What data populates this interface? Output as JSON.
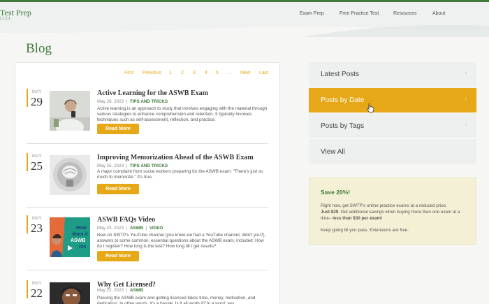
{
  "header": {
    "logo": "Test Prep",
    "logo_sub": "LLCd",
    "nav": [
      "Exam Prep",
      "Free Practice Test",
      "Resources",
      "About"
    ]
  },
  "page_title": "Blog",
  "pagination": {
    "first": "First",
    "previous": "Previous",
    "pages": [
      "1",
      "2",
      "3",
      "4",
      "5"
    ],
    "ellipsis": "...",
    "next": "Next",
    "last": "Last"
  },
  "posts": [
    {
      "month": "MAY",
      "day": "29",
      "title": "Active Learning for the ASWB Exam",
      "date": "May 29, 2023",
      "tags": [
        "TIPS AND TRICKS"
      ],
      "excerpt": "Active learning is an approach to study that involves engaging with the material through various strategies to enhance comprehension and retention. It typically involves techniques such as self-assessment, reflection, and practice.",
      "button": "Read More"
    },
    {
      "month": "MAY",
      "day": "25",
      "title": "Improving Memorization Ahead of the ASWB Exam",
      "date": "May 25, 2023",
      "tags": [
        "TIPS AND TRICKS"
      ],
      "excerpt": "A major complaint from social workers preparing for the ASWB exam: \"There's just so much to memorize.\"  It's true.",
      "button": "Read More"
    },
    {
      "month": "MAY",
      "day": "23",
      "title": "ASWB FAQs Video",
      "date": "May 23, 2023",
      "tags": [
        "ASWB",
        "VIDEO"
      ],
      "excerpt": "New on SWTP's YouTube channel (you knew we had a YouTube channel, didn't you?), answers to some common, essential questions about the ASWB exam, included: How do I register? How long is the test? How long till I get results?",
      "button": "Read More",
      "thumb_text": [
        "How",
        "does it",
        "ASWB",
        "res"
      ]
    },
    {
      "month": "MAY",
      "day": "22",
      "title": "Why Get Licensed?",
      "date": "May 22, 2023",
      "tags": [
        "ASWB"
      ],
      "excerpt": "Passing the ASWB exam and getting licensed takes time, money, motivation, and dedication. In other words, it's a hassle. Is it all worth it? In a word: yes."
    }
  ],
  "sidebar": {
    "items": [
      {
        "label": "Latest Posts",
        "arrow": "›"
      },
      {
        "label": "Posts by Date",
        "arrow": "›"
      },
      {
        "label": "Posts by Tags",
        "arrow": "›"
      },
      {
        "label": "View All",
        "arrow": "›"
      }
    ],
    "active_index": 1
  },
  "promo": {
    "title": "Save 20%!",
    "line1": "Right now, get SWTP's online practice exams at a reduced price.",
    "line2_bold": "Just $39",
    "line2_rest": ". Get additional savings when buying more than one exam at a time– ",
    "line2_bold2": "less than  $30 per exam!",
    "line3": "Keep going till you pass. Extensions are free."
  },
  "colors": {
    "brand_green": "#3f7a3a",
    "accent": "#e6a817"
  }
}
